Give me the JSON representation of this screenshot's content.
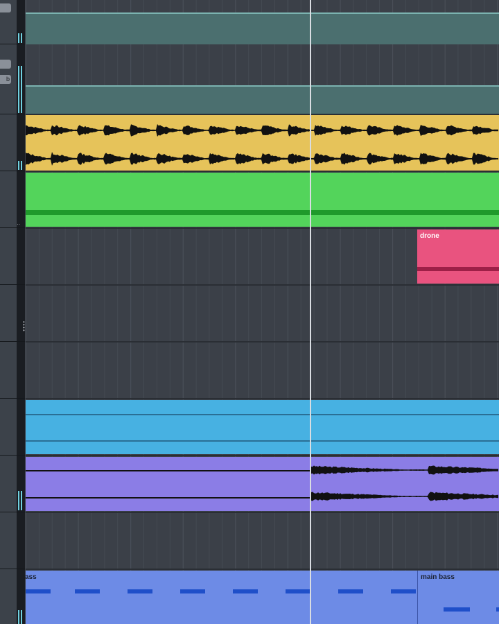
{
  "header": {
    "button_1_label": "",
    "button_2_label": "b"
  },
  "clips": {
    "drone_label": "drone",
    "bass_left_label": "ass",
    "bass_right_label": "main bass"
  },
  "colors": {
    "teal": "#4b6f6f",
    "yellow": "#e6c35a",
    "green": "#53d45b",
    "pink": "#e9537f",
    "blue": "#47b1e2",
    "purple": "#8b7de6",
    "bass": "#6d8be6"
  },
  "icons": {
    "track_menu": "grip-dots-icon"
  }
}
